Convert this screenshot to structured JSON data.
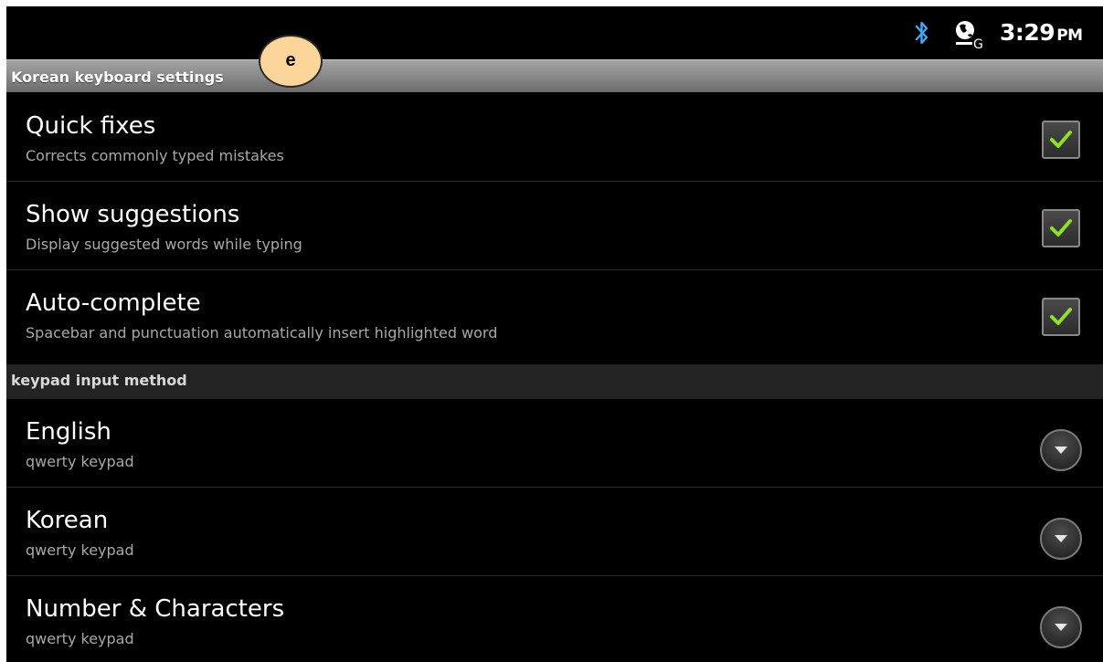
{
  "status_bar": {
    "bluetooth_icon": "bluetooth-icon",
    "network_icon": "globe-g-icon",
    "time": "3:29",
    "ampm": "PM"
  },
  "annotation": {
    "label": "e"
  },
  "sections": [
    {
      "header": "Korean keyboard settings",
      "items": [
        {
          "title": "Quick fixes",
          "summary": "Corrects commonly typed mistakes",
          "control": "checkbox",
          "checked": true
        },
        {
          "title": "Show suggestions",
          "summary": "Display suggested words while typing",
          "control": "checkbox",
          "checked": true
        },
        {
          "title": "Auto-complete",
          "summary": "Spacebar and punctuation automatically insert highlighted word",
          "control": "checkbox",
          "checked": true
        }
      ]
    },
    {
      "header": "keypad input method",
      "items": [
        {
          "title": "English",
          "summary": "qwerty keypad",
          "control": "dropdown"
        },
        {
          "title": "Korean",
          "summary": "qwerty keypad",
          "control": "dropdown"
        },
        {
          "title": "Number & Characters",
          "summary": "qwerty keypad",
          "control": "dropdown"
        }
      ]
    }
  ],
  "colors": {
    "check_green": "#8ee02a",
    "background": "#000000",
    "header_gray": "#8c8c8c"
  }
}
